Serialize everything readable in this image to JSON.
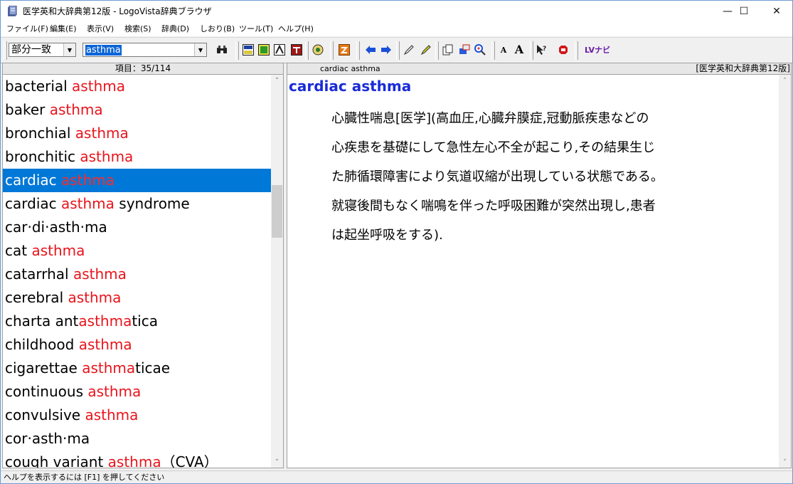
{
  "window": {
    "title": "医学英和大辞典第12版 - LogoVista辞典ブラウザ",
    "minimize": "—",
    "maximize": "☐",
    "close": "✕"
  },
  "menu": [
    "ファイル(F)",
    "編集(E)",
    "表示(V)",
    "検索(S)",
    "辞典(D)",
    "しおり(B)",
    "ツール(T)",
    "ヘルプ(H)"
  ],
  "toolbar": {
    "search_mode": "部分一致",
    "search_text": "asthma",
    "dropdown_arrow": "▼",
    "font_small": "A",
    "font_large": "A",
    "lv_navi": "LVナビ"
  },
  "list_header": "項目：35/114",
  "results": [
    {
      "pre": "bacterial ",
      "match": "asthma",
      "post": ""
    },
    {
      "pre": "baker ",
      "match": "asthma",
      "post": ""
    },
    {
      "pre": "bronchial ",
      "match": "asthma",
      "post": ""
    },
    {
      "pre": "bronchitic ",
      "match": "asthma",
      "post": ""
    },
    {
      "pre": "cardiac ",
      "match": "asthma",
      "post": "",
      "selected": true
    },
    {
      "pre": "cardiac ",
      "match": "asthma",
      "post": " syndrome"
    },
    {
      "pre": "car·di·asth·ma",
      "match": "",
      "post": ""
    },
    {
      "pre": "cat ",
      "match": "asthma",
      "post": ""
    },
    {
      "pre": "catarrhal ",
      "match": "asthma",
      "post": ""
    },
    {
      "pre": "cerebral ",
      "match": "asthma",
      "post": ""
    },
    {
      "pre": "charta ant",
      "match": "asthma",
      "post": "tica"
    },
    {
      "pre": "childhood ",
      "match": "asthma",
      "post": ""
    },
    {
      "pre": "cigarettae ",
      "match": "asthma",
      "post": "ticae"
    },
    {
      "pre": "continuous ",
      "match": "asthma",
      "post": ""
    },
    {
      "pre": "convulsive ",
      "match": "asthma",
      "post": ""
    },
    {
      "pre": "cor·asth·ma",
      "match": "",
      "post": ""
    },
    {
      "pre": "cough variant ",
      "match": "asthma",
      "post": "（CVA）"
    }
  ],
  "entry": {
    "header_word": "cardiac asthma",
    "dictionary": "[医学英和大辞典第12版]",
    "headword": "cardiac asthma",
    "definition_lines": [
      "心臓性喘息[医学](高血圧,心臓弁膜症,冠動脈疾患などの",
      "心疾患を基礎にして急性左心不全が起こり,その結果生じ",
      "た肺循環障害により気道収縮が出現している状態である。",
      "就寝後間もなく喘鳴を伴った呼吸困難が突然出現し,患者",
      "は起坐呼吸をする)."
    ]
  },
  "scroll_up": "˄",
  "scroll_down": "˅",
  "status": "ヘルプを表示するには [F1] を押してください",
  "colors": {
    "match": "#e8141c",
    "selection": "#0078d7",
    "headword": "#1a2bd8"
  }
}
